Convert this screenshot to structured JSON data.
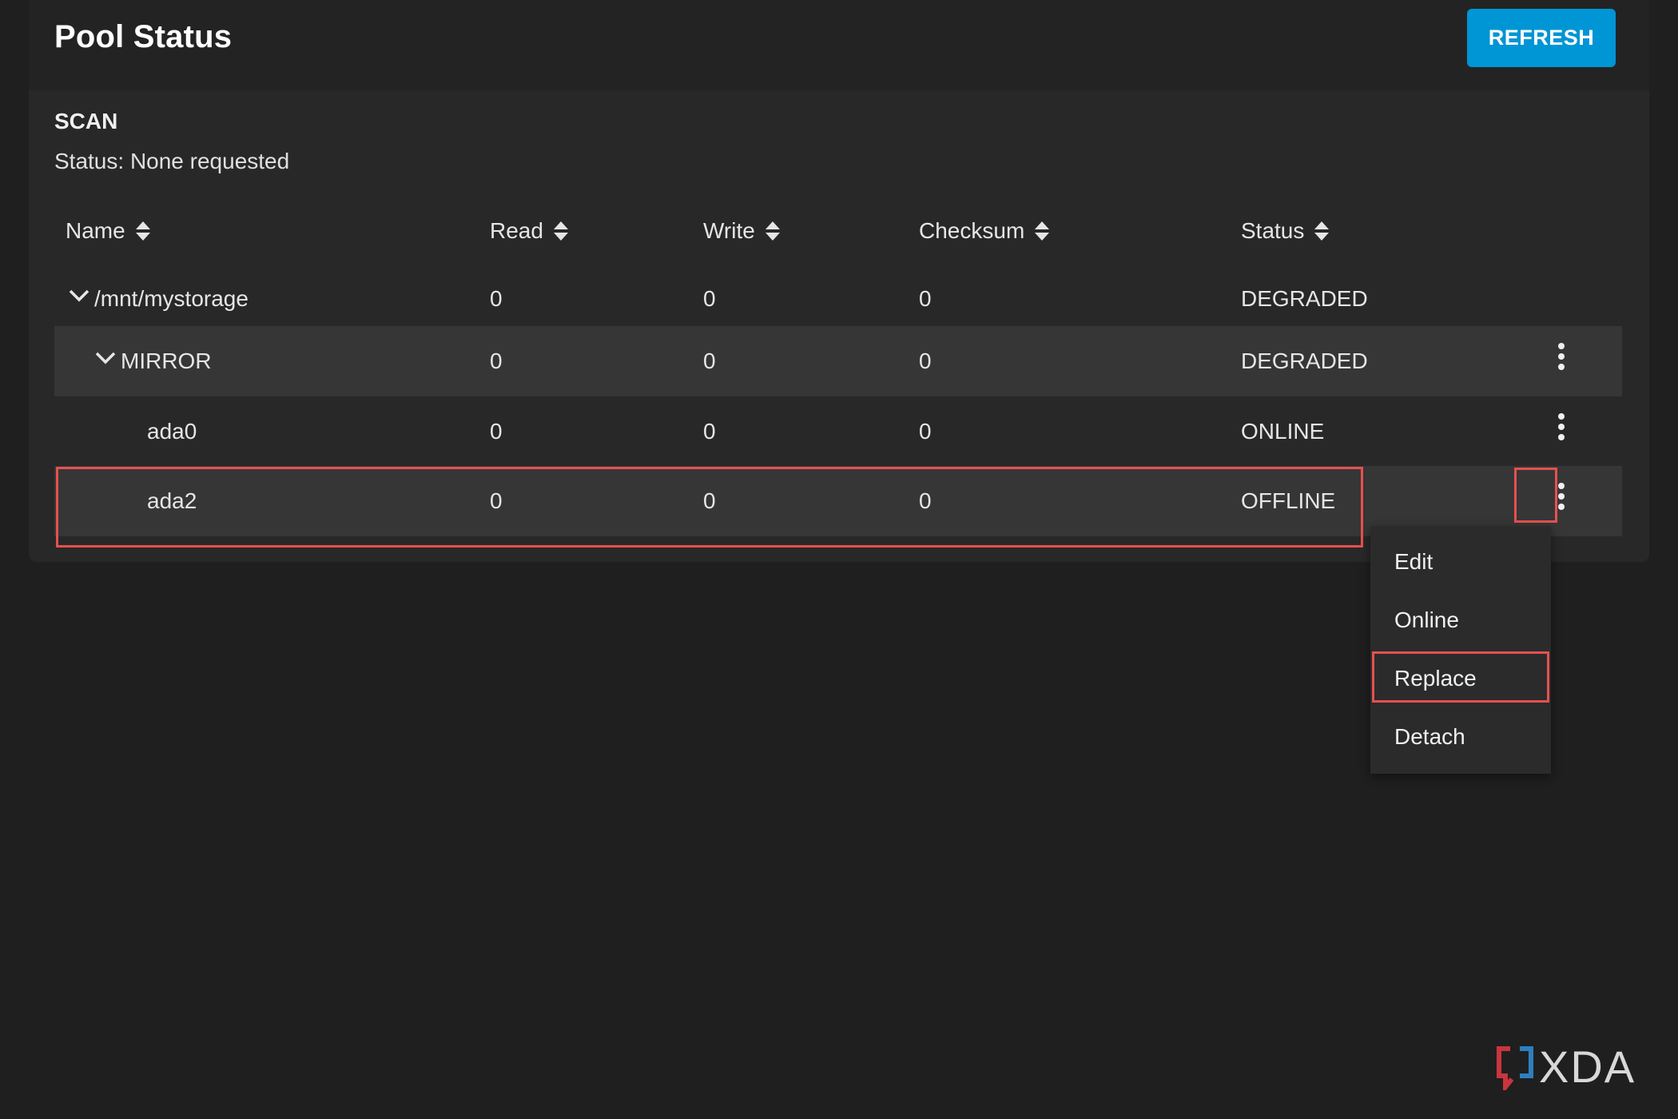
{
  "header": {
    "title": "Pool Status",
    "refresh_label": "REFRESH"
  },
  "scan": {
    "heading": "SCAN",
    "status": "Status: None requested"
  },
  "table": {
    "columns": [
      "Name",
      "Read",
      "Write",
      "Checksum",
      "Status"
    ],
    "rows": [
      {
        "name": "/mnt/mystorage",
        "read": "0",
        "write": "0",
        "checksum": "0",
        "status": "DEGRADED"
      },
      {
        "name": "MIRROR",
        "read": "0",
        "write": "0",
        "checksum": "0",
        "status": "DEGRADED"
      },
      {
        "name": "ada0",
        "read": "0",
        "write": "0",
        "checksum": "0",
        "status": "ONLINE"
      },
      {
        "name": "ada2",
        "read": "0",
        "write": "0",
        "checksum": "0",
        "status": "OFFLINE"
      }
    ]
  },
  "menu": {
    "items": [
      "Edit",
      "Online",
      "Replace",
      "Detach"
    ]
  },
  "watermark": {
    "text": "XDA"
  },
  "colors": {
    "accent": "#0095d5",
    "highlight": "#e5514f",
    "background": "#1f1f1f",
    "card": "#282828"
  },
  "icons": {
    "sort": "sort-updown-icon",
    "expand": "chevron-down-icon",
    "more": "kebab-menu-icon",
    "logo": "xda-logo-icon"
  }
}
